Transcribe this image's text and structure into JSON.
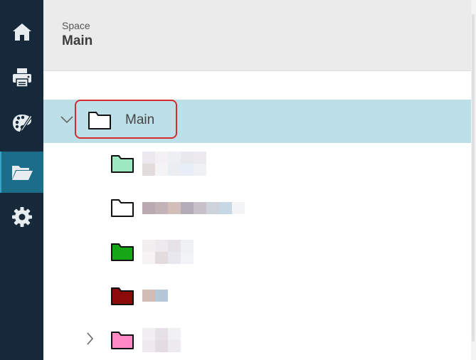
{
  "nav": {
    "items": [
      {
        "icon": "home-icon",
        "active": false
      },
      {
        "icon": "printer-icon",
        "active": false
      },
      {
        "icon": "palette-icon",
        "active": false
      },
      {
        "icon": "folder-open-icon",
        "active": true
      },
      {
        "icon": "gear-icon",
        "active": false
      }
    ],
    "colors": {
      "rail": "#15293a",
      "active": "#1c6d89",
      "icon": "#e6ecef"
    }
  },
  "header": {
    "caption": "Space",
    "title": "Main"
  },
  "tree": {
    "root": {
      "label": "Main",
      "expanded": true,
      "selected": true,
      "folder_color": "#ffffff"
    },
    "children": [
      {
        "folder_color": "#9be8c1",
        "has_children": false
      },
      {
        "folder_color": "#ffffff",
        "has_children": false
      },
      {
        "folder_color": "#16a616",
        "has_children": false
      },
      {
        "folder_color": "#8b0a0a",
        "has_children": false
      },
      {
        "folder_color": "#ff88c6",
        "has_children": true
      }
    ],
    "selected_row_color": "#bcdfe8",
    "highlight_border_color": "#d62b2b"
  }
}
